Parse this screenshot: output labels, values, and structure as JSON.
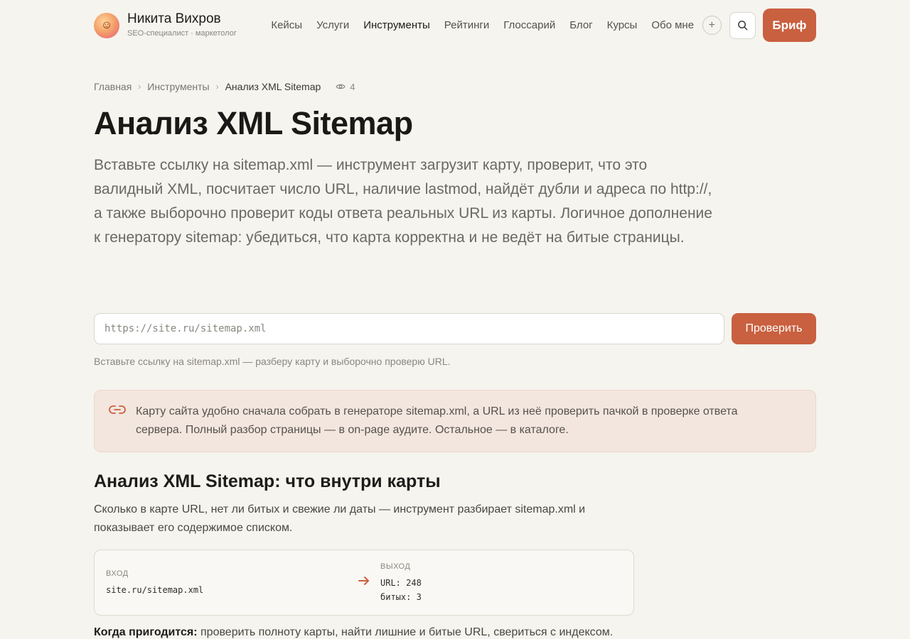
{
  "header": {
    "brand_name": "Никита Вихров",
    "brand_sub": "SEO-специалист · маркетолог",
    "nav": [
      "Кейсы",
      "Услуги",
      "Инструменты",
      "Рейтинги",
      "Глоссарий",
      "Блог",
      "Курсы",
      "Обо мне"
    ],
    "active_nav": "Инструменты",
    "plus_label": "+",
    "brief_label": "Бриф"
  },
  "breadcrumb": {
    "home": "Главная",
    "section": "Инструменты",
    "current": "Анализ XML Sitemap",
    "views": "4"
  },
  "page": {
    "title": "Анализ XML Sitemap",
    "lead": "Вставьте ссылку на sitemap.xml — инструмент загрузит карту, проверит, что это валидный XML, посчитает число URL, наличие lastmod, найдёт дубли и адреса по http://, а также выборочно проверит коды ответа реальных URL из карты. Логичное дополнение к генератору sitemap: убедиться, что карта корректна и не ведёт на битые страницы."
  },
  "form": {
    "placeholder": "https://site.ru/sitemap.xml",
    "value": "",
    "submit_label": "Проверить",
    "hint": "Вставьте ссылку на sitemap.xml — разберу карту и выборочно проверю URL."
  },
  "notice": {
    "text": "Карту сайта удобно сначала собрать в генераторе sitemap.xml, а URL из неё проверить пачкой в проверке ответа сервера. Полный разбор страницы — в on-page аудите. Остальное — в каталоге."
  },
  "section": {
    "title": "Анализ XML Sitemap: что внутри карты",
    "desc": "Сколько в карте URL, нет ли битых и свежие ли даты — инструмент разбирает sitemap.xml и показывает его содержимое списком."
  },
  "io": {
    "input_label": "ВХОД",
    "input_value": "site.ru/sitemap.xml",
    "output_label": "ВЫХОД",
    "output_line1": "URL: 248",
    "output_line2": "битых: 3"
  },
  "when": {
    "label": "Когда пригодится:",
    "text": " проверить полноту карты, найти лишние и битые URL, свериться с индексом."
  },
  "colors": {
    "accent": "#c9603f",
    "background": "#f5f4ee",
    "notice_bg": "#f3e6de"
  }
}
